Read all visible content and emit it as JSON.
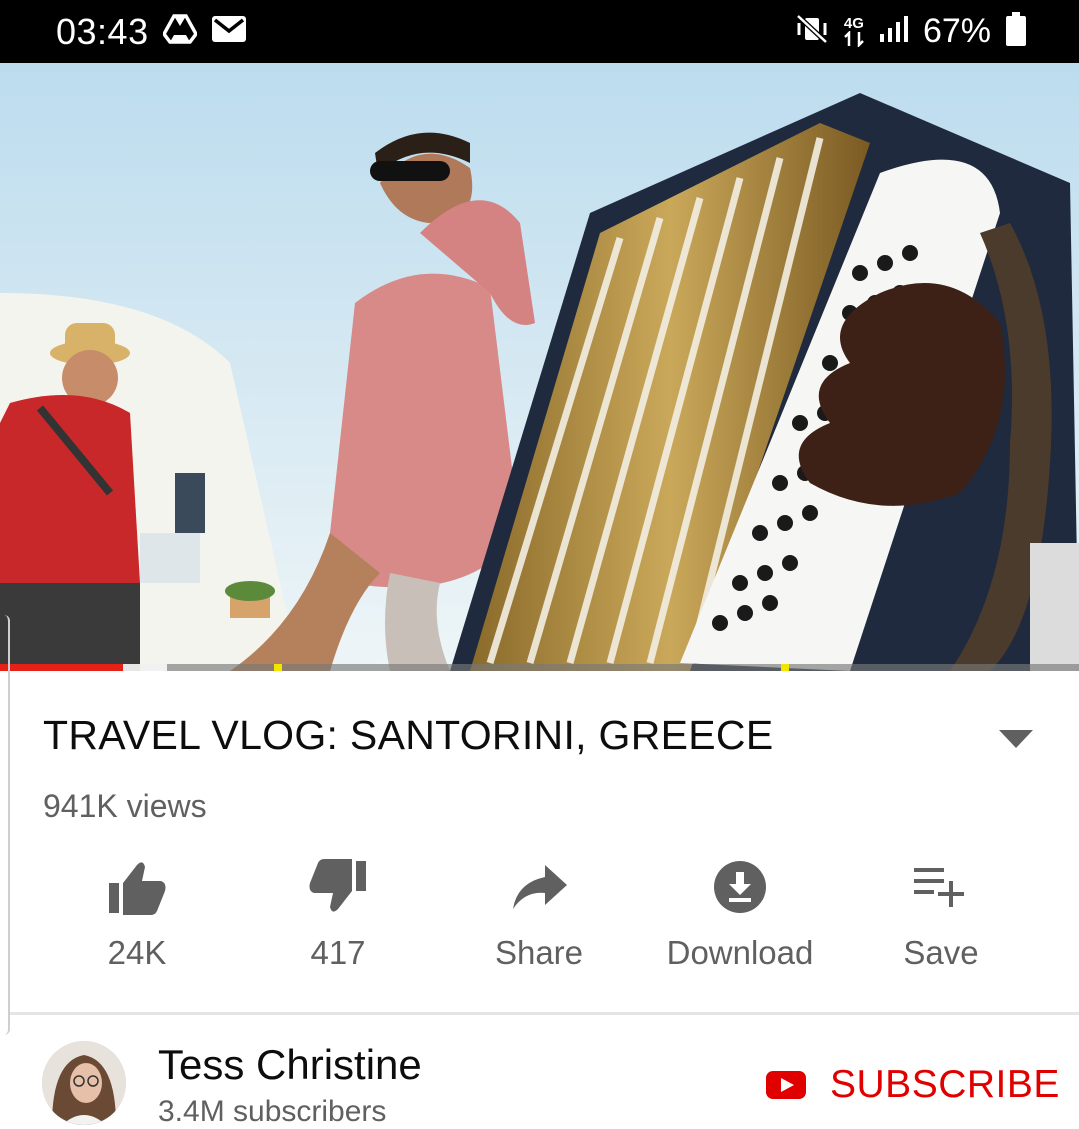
{
  "status_bar": {
    "time": "03:43",
    "network": "4G",
    "battery": "67%",
    "left_icons": [
      "drive-icon",
      "mail-icon"
    ],
    "right_icons": [
      "vibrate-mute-icon",
      "data-arrows-icon",
      "signal-icon",
      "battery-icon"
    ]
  },
  "player": {
    "progress_fraction": 0.114,
    "buffered_fraction": 0.155,
    "chapter_markers": [
      0.254,
      0.724
    ],
    "colors": {
      "progress": "#e62117",
      "marker": "#f2e600"
    }
  },
  "video": {
    "title": "TRAVEL VLOG: SANTORINI, GREECE",
    "views": "941K views"
  },
  "actions": [
    {
      "id": "like",
      "label": "24K",
      "icon": "thumbs-up-icon"
    },
    {
      "id": "dislike",
      "label": "417",
      "icon": "thumbs-down-icon"
    },
    {
      "id": "share",
      "label": "Share",
      "icon": "share-icon"
    },
    {
      "id": "download",
      "label": "Download",
      "icon": "download-icon"
    },
    {
      "id": "save",
      "label": "Save",
      "icon": "playlist-add-icon"
    }
  ],
  "channel": {
    "name": "Tess Christine",
    "subscribers": "3.4M subscribers",
    "subscribe_label": "SUBSCRIBE",
    "subscribe_color": "#e00000"
  }
}
